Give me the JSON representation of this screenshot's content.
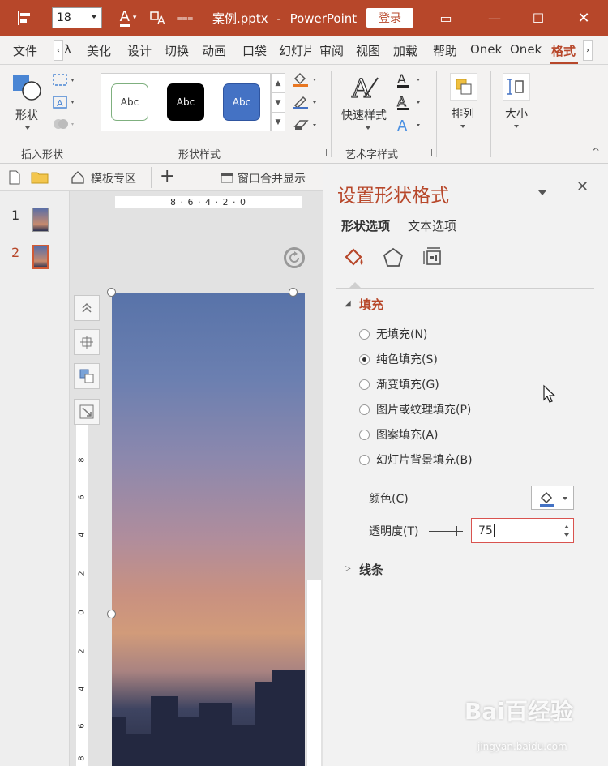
{
  "titlebar": {
    "font_size": "18",
    "filename": "案例.pptx",
    "separator": "-",
    "app_name": "PowerPoint",
    "login_label": "登录",
    "more_glyph": "⩶",
    "restore_glyph": "▭",
    "minimize_glyph": "—",
    "maximize_glyph": "☐",
    "close_glyph": "✕"
  },
  "tabs": [
    "文件",
    "λ",
    "美化",
    "设计",
    "切换",
    "动画",
    "口袋",
    "幻灯片",
    "审阅",
    "视图",
    "加载",
    "帮助",
    "Onek",
    "Onek",
    "格式"
  ],
  "tab_left_arrow": "‹",
  "tab_right_arrow": "›",
  "ribbon": {
    "insert_shape": {
      "shape_label": "形状",
      "group_label": "插入形状"
    },
    "shape_styles": {
      "samples": [
        "Abc",
        "Abc",
        "Abc"
      ],
      "group_label": "形状样式"
    },
    "wordart": {
      "quick_styles_label": "快速样式",
      "group_label": "艺术字样式"
    },
    "arrange_label": "排列",
    "size_label": "大小"
  },
  "strip": {
    "template_label": "模板专区",
    "add_label": "+",
    "merge_label": "窗口合并显示"
  },
  "slides": [
    {
      "number": "1"
    },
    {
      "number": "2"
    }
  ],
  "rulers": {
    "horizontal": "8 · 6 · 4 · 2 · 0",
    "vertical": [
      "8",
      "6",
      "4",
      "2",
      "0",
      "2",
      "4",
      "6",
      "8"
    ]
  },
  "pane": {
    "title": "设置形状格式",
    "tabs": [
      "形状选项",
      "文本选项"
    ],
    "fill": {
      "heading": "填充",
      "options": [
        {
          "label": "无填充(N)",
          "checked": false
        },
        {
          "label": "纯色填充(S)",
          "checked": true
        },
        {
          "label": "渐变填充(G)",
          "checked": false
        },
        {
          "label": "图片或纹理填充(P)",
          "checked": false
        },
        {
          "label": "图案填充(A)",
          "checked": false
        },
        {
          "label": "幻灯片背景填充(B)",
          "checked": false
        }
      ],
      "color_label": "颜色(C)",
      "transparency_label": "透明度(T)",
      "transparency_value": "75"
    },
    "line_heading": "线条"
  },
  "watermark": {
    "brand": "Bai百经验",
    "url": "jingyan.baidu.com"
  },
  "colors": {
    "accent": "#b7472a",
    "pane_title": "#b7472a",
    "input_border": "#d9534f",
    "style2": "#000000",
    "style3": "#4472c4"
  }
}
